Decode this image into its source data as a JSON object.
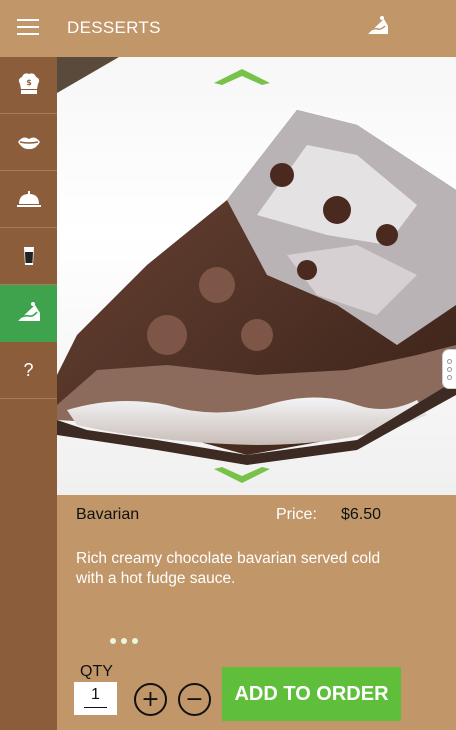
{
  "header": {
    "title": "DESSERTS",
    "menu_icon": "hamburger-icon",
    "category_icon": "cake-slice-icon"
  },
  "sidebar": {
    "items": [
      {
        "icon": "chef-hat-dollar-icon"
      },
      {
        "icon": "lips-icon"
      },
      {
        "icon": "serving-cloche-icon"
      },
      {
        "icon": "drink-glass-icon"
      },
      {
        "icon": "cake-slice-icon",
        "active": true
      },
      {
        "label": "?"
      }
    ]
  },
  "item": {
    "name": "Bavarian",
    "price_label": "Price:",
    "price": "$6.50",
    "description": "Rich creamy chocolate bavarian served cold with a hot fudge sauce."
  },
  "order": {
    "qty_label": "QTY",
    "qty_value": "1",
    "plus": "+",
    "minus": "−",
    "add_button": "ADD TO ORDER"
  },
  "colors": {
    "brown_light": "#c1976a",
    "brown_dark": "#8b5d3b",
    "green": "#3fa34d",
    "button_green": "#5fbf3a"
  }
}
